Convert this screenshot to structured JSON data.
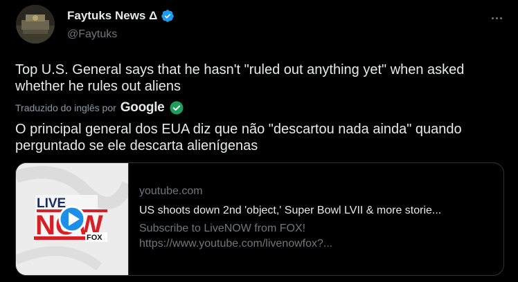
{
  "author": {
    "name": "Faytuks News Δ",
    "handle": "@Faytuks"
  },
  "tweet": {
    "text": "Top U.S. General says that he hasn't \"ruled out anything yet\" when asked whether he rules out aliens",
    "translation_label": "Traduzido do inglês por",
    "translation_provider": "Google",
    "translated_text": "O principal general dos EUA diz que não \"descartou nada ainda\" quando perguntado se ele descarta alienígenas"
  },
  "card": {
    "domain": "youtube.com",
    "title": "US shoots down 2nd 'object,' Super Bowl LVII & more storie...",
    "description": "Subscribe to LiveNOW from FOX!",
    "url": "https://www.youtube.com/livenowfox?...",
    "thumbnail": {
      "live_text": "LIVE",
      "now_text": "NOW",
      "fox_text": "FOX"
    }
  },
  "colors": {
    "verified": "#1d9bf0",
    "check": "#1f9e5b",
    "play": "#1d8fe8",
    "brand_red": "#d61f26",
    "brand_navy": "#1a2a5c"
  },
  "icons": [
    "verified-badge-icon",
    "more-options-icon",
    "translation-check-icon",
    "play-icon"
  ]
}
